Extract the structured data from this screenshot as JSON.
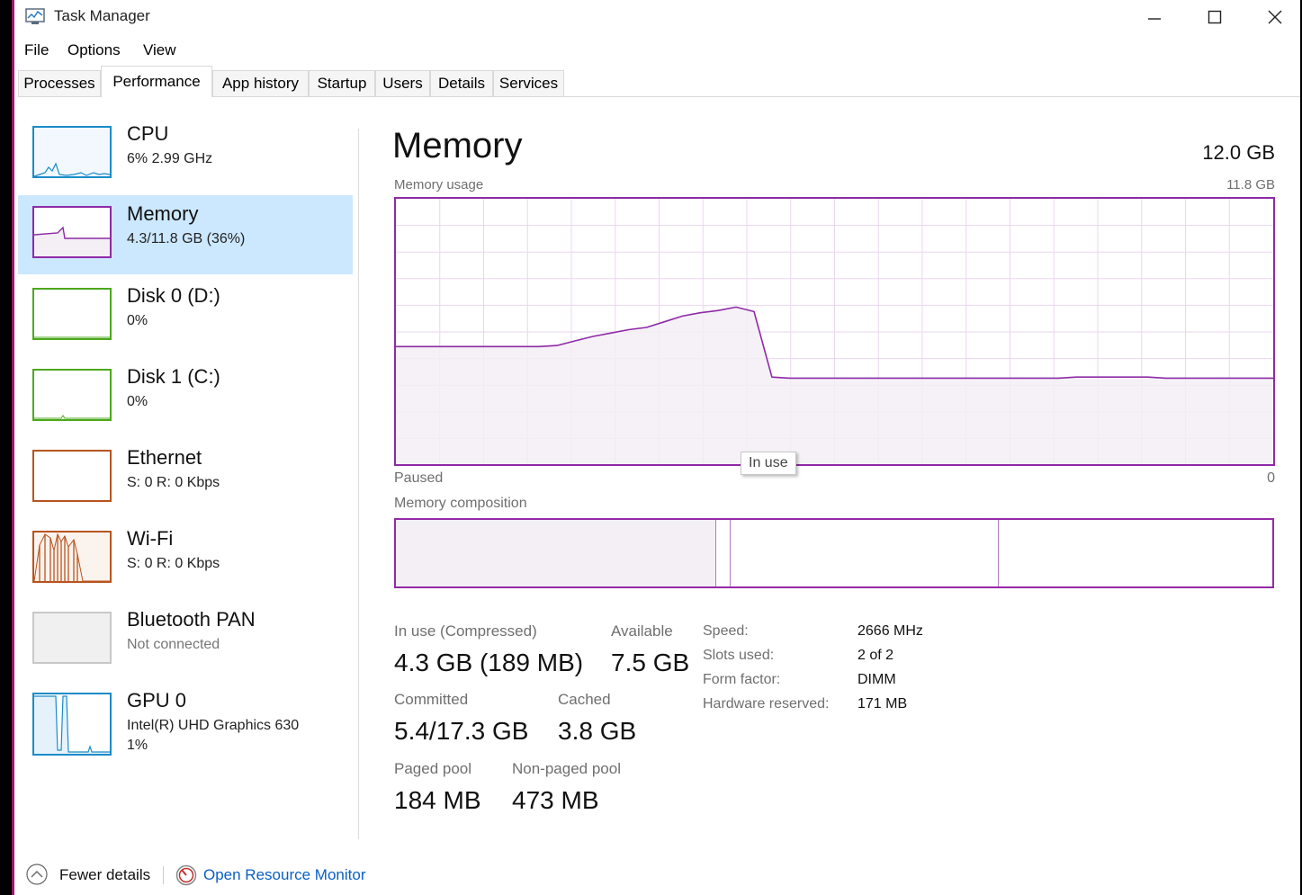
{
  "window": {
    "title": "Task Manager"
  },
  "menu": [
    "File",
    "Options",
    "View"
  ],
  "tabs": [
    "Processes",
    "Performance",
    "App history",
    "Startup",
    "Users",
    "Details",
    "Services"
  ],
  "active_tab": "Performance",
  "sidebar": [
    {
      "name": "CPU",
      "sub": "6%  2.99 GHz",
      "color": "#1a8cc8",
      "selected": false
    },
    {
      "name": "Memory",
      "sub": "4.3/11.8 GB (36%)",
      "color": "#8e2aa6",
      "selected": true
    },
    {
      "name": "Disk 0 (D:)",
      "sub": "0%",
      "color": "#4ca81c",
      "selected": false
    },
    {
      "name": "Disk 1 (C:)",
      "sub": "0%",
      "color": "#4ca81c",
      "selected": false
    },
    {
      "name": "Ethernet",
      "sub": "S: 0  R: 0 Kbps",
      "color": "#b8541d",
      "selected": false
    },
    {
      "name": "Wi-Fi",
      "sub": "S: 0  R: 0 Kbps",
      "color": "#b8541d",
      "selected": false
    },
    {
      "name": "Bluetooth PAN",
      "sub": "Not connected",
      "color": "#bbbbbb",
      "selected": false
    },
    {
      "name": "GPU 0",
      "sub": "Intel(R) UHD Graphics 630",
      "sub2": "1%",
      "color": "#1a8cc8",
      "selected": false
    }
  ],
  "main": {
    "title": "Memory",
    "total": "12.0 GB",
    "usage_label": "Memory usage",
    "usage_max": "11.8 GB",
    "paused_label": "Paused",
    "zero_label": "0",
    "tooltip": "In use",
    "composition_label": "Memory composition"
  },
  "chart_data": {
    "type": "area",
    "title": "Memory usage",
    "series": [
      {
        "name": "In use",
        "values": [
          5.25,
          5.25,
          5.25,
          5.25,
          5.25,
          5.25,
          5.25,
          5.25,
          5.25,
          5.3,
          5.5,
          5.7,
          5.85,
          6.0,
          6.1,
          6.35,
          6.6,
          6.75,
          6.85,
          7.0,
          6.8,
          3.9,
          3.85,
          3.85,
          3.85,
          3.85,
          3.85,
          3.85,
          3.85,
          3.85,
          3.85,
          3.85,
          3.85,
          3.85,
          3.85,
          3.85,
          3.85,
          3.85,
          3.9,
          3.9,
          3.9,
          3.9,
          3.9,
          3.85,
          3.85,
          3.85,
          3.85,
          3.85,
          3.85,
          3.85
        ]
      }
    ],
    "ylim": [
      0,
      11.8
    ],
    "grid": true
  },
  "composition": {
    "in_use_gb": 4.3,
    "modified_gb": 0.2,
    "standby_gb": 3.6,
    "free_gb": 3.7
  },
  "stats": {
    "in_use_label": "In use (Compressed)",
    "in_use_value": "4.3 GB (189 MB)",
    "available_label": "Available",
    "available_value": "7.5 GB",
    "committed_label": "Committed",
    "committed_value": "5.4/17.3 GB",
    "cached_label": "Cached",
    "cached_value": "3.8 GB",
    "paged_label": "Paged pool",
    "paged_value": "184 MB",
    "nonpaged_label": "Non-paged pool",
    "nonpaged_value": "473 MB"
  },
  "specs": [
    {
      "label": "Speed:",
      "value": "2666 MHz"
    },
    {
      "label": "Slots used:",
      "value": "2 of 2"
    },
    {
      "label": "Form factor:",
      "value": "DIMM"
    },
    {
      "label": "Hardware reserved:",
      "value": "171 MB"
    }
  ],
  "footer": {
    "fewer_details": "Fewer details",
    "open_resource_monitor": "Open Resource Monitor"
  },
  "colors": {
    "memory_accent": "#8e2aa6",
    "memory_fill": "#f3eff5",
    "grid": "#ead6ef",
    "selected_bg": "#cce8ff",
    "link": "#0a5fc3"
  }
}
